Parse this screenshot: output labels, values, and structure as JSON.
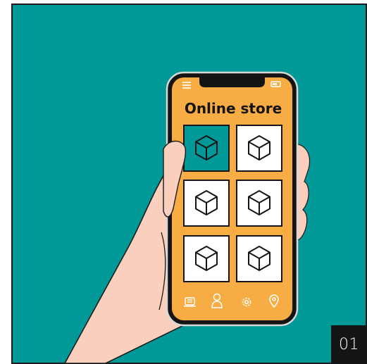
{
  "scene": {
    "background_color": "#019997",
    "frame_color": "#1a1a1a",
    "skin_color": "#fbcfbe",
    "phone_screen_color": "#f8ad44",
    "selected_tile_color": "#019997"
  },
  "app": {
    "title": "Online store",
    "menu_icon": "hamburger-menu-icon",
    "battery_icon": "battery-icon",
    "selected_tile_index": 0,
    "tiles": [
      {
        "icon": "box-icon"
      },
      {
        "icon": "box-icon"
      },
      {
        "icon": "box-icon"
      },
      {
        "icon": "box-icon"
      },
      {
        "icon": "box-icon"
      },
      {
        "icon": "box-icon"
      }
    ],
    "bottom_nav": [
      {
        "icon": "catalog-icon"
      },
      {
        "icon": "profile-icon"
      },
      {
        "icon": "settings-icon"
      },
      {
        "icon": "map-pin-icon"
      }
    ]
  },
  "page_number": "01"
}
